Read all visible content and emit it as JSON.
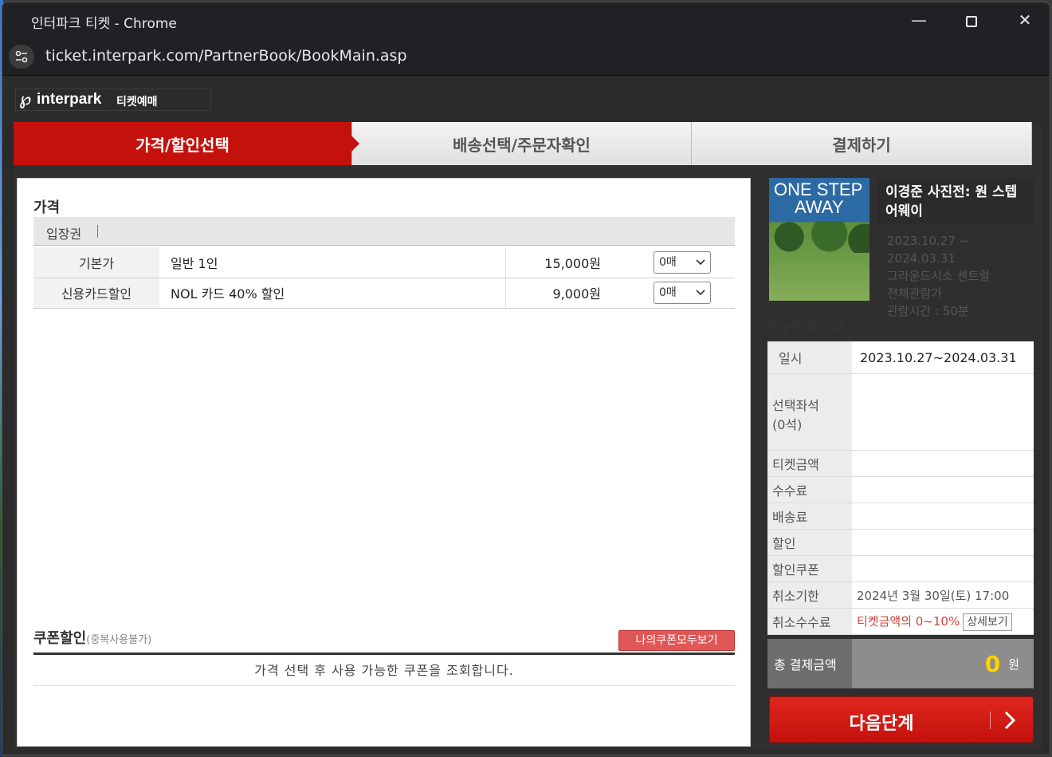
{
  "window": {
    "title": "인터파크 티켓 - Chrome",
    "url": "ticket.interpark.com/PartnerBook/BookMain.asp",
    "controls": [
      "minimize-icon",
      "maximize-icon",
      "close-icon"
    ]
  },
  "logo": {
    "text": "interpark",
    "sub": "티켓예매"
  },
  "steps": [
    {
      "label": "가격/할인선택",
      "active": true
    },
    {
      "label": "배송선택/주문자확인",
      "active": false
    },
    {
      "label": "결제하기",
      "active": false
    }
  ],
  "price": {
    "section_title": "가격",
    "tab_label": "입장권",
    "rows": [
      {
        "kind": "기본가",
        "name": "일반 1인",
        "amount": "15,000원",
        "qty": "0매"
      },
      {
        "kind": "신용카드할인",
        "name": "NOL 카드 40% 할인",
        "amount": "9,000원",
        "qty": "0매"
      }
    ]
  },
  "coupon": {
    "title": "쿠폰할인",
    "note": "(중복사용불가)",
    "button": "나의쿠폰모두보기",
    "message": "가격 선택 후 사용 가능한 쿠폰을 조회합니다."
  },
  "show": {
    "poster_line1": "ONE STEP",
    "poster_line2": "AWAY",
    "title": "이경준 사진전: 원 스텝 어웨이",
    "date_start": "2023.10.27 ~",
    "date_end": "2024.03.31",
    "venue": "그라운드시소 센트럴",
    "rating": "전체관람가",
    "runtime": "관람시간 : 50분"
  },
  "my": {
    "title": "My예매정보",
    "rows": [
      {
        "k": "일시",
        "v": "2023.10.27~2024.03.31"
      },
      {
        "k": "선택좌석\n(0석)",
        "v": ""
      },
      {
        "k": "티켓금액",
        "v": ""
      },
      {
        "k": "수수료",
        "v": ""
      },
      {
        "k": "배송료",
        "v": ""
      },
      {
        "k": "할인",
        "v": ""
      },
      {
        "k": "할인쿠폰",
        "v": ""
      },
      {
        "k": "취소기한",
        "v": "2024년 3월 30일(토) 17:00"
      },
      {
        "k": "취소수수료",
        "v": "티켓금액의 0~10%"
      }
    ],
    "detail_button": "상세보기",
    "total_label": "총 결제금액",
    "total_value": "0",
    "total_unit": "원",
    "next_button": "다음단계"
  },
  "colors": {
    "accent": "#c4110c",
    "warning_text": "#d0413a",
    "total_value": "#ffd200"
  }
}
